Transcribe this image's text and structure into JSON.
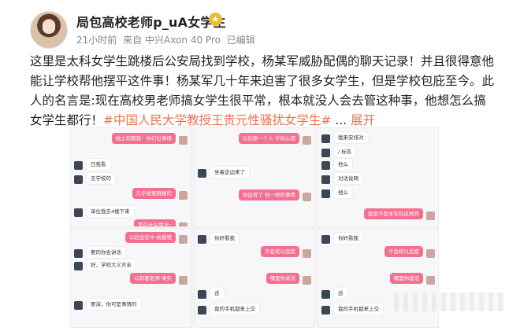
{
  "post": {
    "username": "局包高校老师p_uA女学生",
    "vip_icon": "crown-icon",
    "time": "21小时前",
    "source_prefix": "来自",
    "device": "中兴Axon 40 Pro",
    "edited": "已编辑",
    "text_main": "这里是太科女学生跳楼后公安局找到学校，杨某军威胁配偶的聊天记录！并且很得意他能让学校帮他摆平这件事！杨某军几十年来迫害了很多女学生，但是学校包庇至今。此人的名言是:现在高校男老师搞女学生很平常，根本就没人会去管这种事，他想怎么搞女学生都行！",
    "hashtag": "#中国人民大学教授王贵元性骚扰女学生#",
    "ellipsis": " ... ",
    "expand": "展开"
  },
  "images": {
    "cells": [
      {
        "bubbles": [
          {
            "side": "right",
            "color": "pink",
            "text": "她之前跟我·· 你们出事情",
            "t": 6
          },
          {
            "side": "left",
            "color": "white",
            "text": "日我看",
            "t": 38
          },
          {
            "side": "left",
            "color": "white",
            "text": "去学校的",
            "t": 56
          },
          {
            "side": "right",
            "color": "pink",
            "text": "几乎说要跳楼的",
            "t": 76
          },
          {
            "side": "left",
            "color": "white",
            "text": "单位我去4楼下来",
            "t": 98
          },
          {
            "side": "right",
            "color": "pink",
            "text": "是在什么情况··",
            "t": 116
          }
        ]
      },
      {
        "bubbles": [
          {
            "side": "right",
            "color": "pink",
            "text": "以后跟一个人·学校心理",
            "t": 6
          },
          {
            "side": "left",
            "color": "white",
            "text": "坐着这边来了",
            "t": 48
          },
          {
            "side": "right",
            "color": "pink",
            "text": "你这样了 他一样的事情",
            "t": 78
          }
        ]
      },
      {
        "bubbles": [
          {
            "side": "left",
            "color": "white",
            "text": "我来安排对",
            "t": 4
          },
          {
            "side": "left",
            "color": "white",
            "text": "/ 标名",
            "t": 22
          },
          {
            "side": "left",
            "color": "white",
            "text": "他么",
            "t": 38
          },
          {
            "side": "left",
            "color": "white",
            "text": "对话说网",
            "t": 56
          },
          {
            "side": "left",
            "color": "white",
            "text": "他么",
            "t": 74
          },
          {
            "side": "right",
            "color": "pink",
            "text": "就是不是本实际这样的",
            "t": 102
          }
        ]
      },
      {
        "bubbles": [
          {
            "side": "right",
            "color": "pink",
            "text": "以后会在中·给我哦",
            "t": 4
          },
          {
            "side": "left",
            "color": "white",
            "text": "要的你会讲话",
            "t": 22
          },
          {
            "side": "left",
            "color": "white",
            "text": "好，学校大义灭亲",
            "t": 38
          },
          {
            "side": "right",
            "color": "pink",
            "text": "以前都老师·事实",
            "t": 56
          },
          {
            "side": "left",
            "color": "white",
            "text": "要演，你可是事情的",
            "t": 88
          }
        ]
      },
      {
        "bubbles": [
          {
            "side": "left",
            "color": "white",
            "text": "你好看我",
            "t": 4
          },
          {
            "side": "right",
            "color": "pink",
            "text": "不会校以后是",
            "t": 22
          },
          {
            "side": "right",
            "color": "pink",
            "text": "哪里你说话",
            "t": 56
          },
          {
            "side": "left",
            "color": "white",
            "text": "适",
            "t": 74
          },
          {
            "side": "left",
            "color": "white",
            "text": "我的手机都来上交",
            "t": 94
          }
        ]
      },
      {
        "bubbles": [
          {
            "side": "left",
            "color": "white",
            "text": "你好看我",
            "t": 4
          },
          {
            "side": "right",
            "color": "pink",
            "text": "不会校以后是",
            "t": 22
          },
          {
            "side": "right",
            "color": "pink",
            "text": "哪里你说话",
            "t": 56
          },
          {
            "side": "left",
            "color": "white",
            "text": "适",
            "t": 74
          },
          {
            "side": "left",
            "color": "white",
            "text": "我的手机都来上交",
            "t": 94
          }
        ]
      }
    ]
  },
  "colors": {
    "accent": "#eb7350",
    "bubble_pink": "#f46f92",
    "badge": "#f1b93b"
  }
}
